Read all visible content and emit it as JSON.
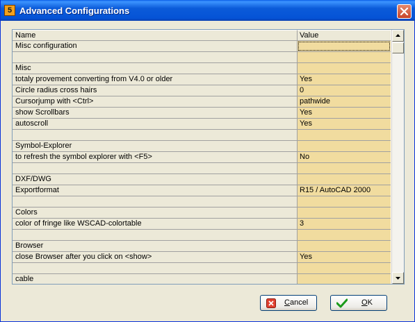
{
  "window": {
    "title": "Advanced Configurations",
    "app_icon_glyph": "5"
  },
  "grid": {
    "columns": {
      "name": "Name",
      "value": "Value"
    },
    "rows": [
      {
        "name": "Misc configuration",
        "value": ""
      },
      {
        "name": "",
        "value": ""
      },
      {
        "name": "Misc",
        "value": ""
      },
      {
        "name": "totaly provement converting from V4.0 or older",
        "value": "Yes"
      },
      {
        "name": "Circle radius cross hairs",
        "value": "0"
      },
      {
        "name": "Cursorjump with  <Ctrl>",
        "value": "pathwide"
      },
      {
        "name": "show Scrollbars",
        "value": "Yes"
      },
      {
        "name": "autoscroll",
        "value": "Yes"
      },
      {
        "name": "",
        "value": ""
      },
      {
        "name": "Symbol-Explorer",
        "value": ""
      },
      {
        "name": "to refresh the symbol explorer with <F5>",
        "value": "No"
      },
      {
        "name": "",
        "value": ""
      },
      {
        "name": "DXF/DWG",
        "value": ""
      },
      {
        "name": "Exportformat",
        "value": "R15 / AutoCAD 2000"
      },
      {
        "name": "",
        "value": ""
      },
      {
        "name": "Colors",
        "value": ""
      },
      {
        "name": "color of fringe like WSCAD-colortable",
        "value": "3"
      },
      {
        "name": "",
        "value": ""
      },
      {
        "name": "Browser",
        "value": ""
      },
      {
        "name": "close Browser after you click on <show>",
        "value": "Yes"
      },
      {
        "name": "",
        "value": ""
      },
      {
        "name": "cable",
        "value": ""
      },
      {
        "name": "",
        "value": ""
      }
    ]
  },
  "buttons": {
    "cancel": {
      "mnemonic": "C",
      "rest": "ancel",
      "icon": "red-x-icon"
    },
    "ok": {
      "mnemonic": "O",
      "rest": "K",
      "icon": "green-check-icon"
    }
  },
  "colors": {
    "value_cell": "#f1dc9f",
    "title_bar": "#0553d6",
    "dialog_bg": "#ece9d8"
  }
}
